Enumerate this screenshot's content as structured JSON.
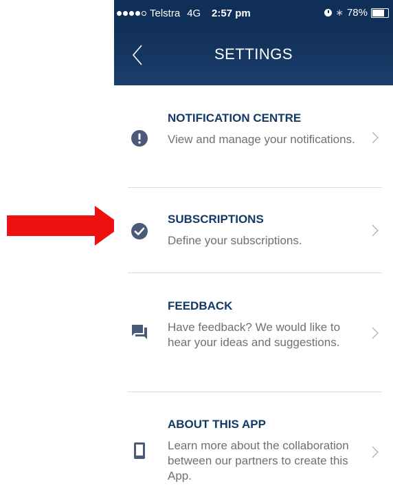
{
  "status_bar": {
    "carrier": "Telstra",
    "network": "4G",
    "time": "2:57 pm",
    "battery_percent": "78%",
    "battery_level": 0.78,
    "signal_bars_filled": 4,
    "signal_bars_total": 5
  },
  "header": {
    "title": "SETTINGS",
    "back_icon": "chevron-left-icon",
    "background": "#102f58"
  },
  "settings": {
    "items": [
      {
        "title": "NOTIFICATION CENTRE",
        "description": "View and manage your notifications.",
        "icon": "exclamation-circle-icon"
      },
      {
        "title": "SUBSCRIPTIONS",
        "description": "Define your subscriptions.",
        "icon": "check-circle-icon"
      },
      {
        "title": "FEEDBACK",
        "description": "Have feedback? We would like to hear your ideas and suggestions.",
        "icon": "chat-bubbles-icon"
      },
      {
        "title": "ABOUT THIS APP",
        "description": "Learn more about the collaboration between our partners to create this App.",
        "icon": "phone-icon"
      }
    ]
  },
  "colors": {
    "title": "#123a66",
    "description": "#707070",
    "icon": "#4a5a78",
    "annotation_arrow": "#ee1111"
  },
  "annotation": {
    "icon": "red-arrow-icon"
  }
}
